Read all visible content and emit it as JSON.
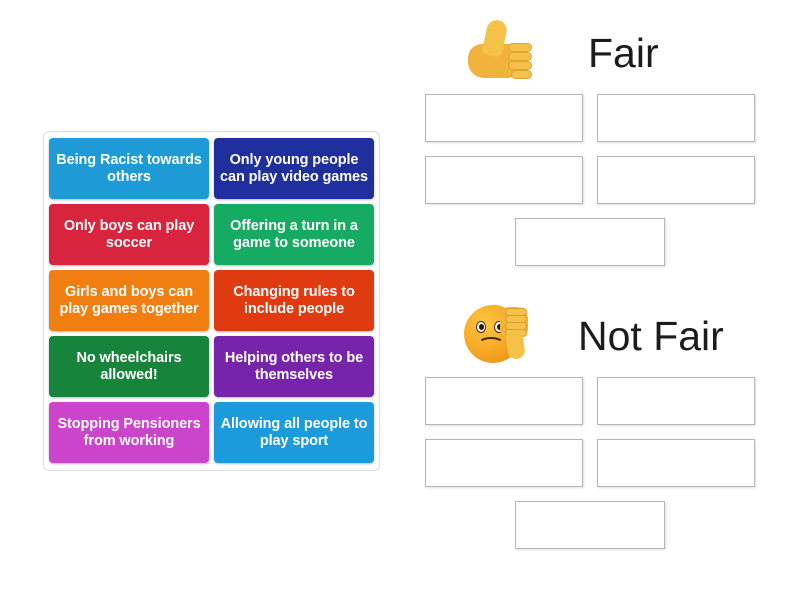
{
  "activity": {
    "type": "sort-into-groups",
    "tile_bank": {
      "tiles": [
        {
          "text": "Being Racist towards others",
          "color": "#1e9ad6"
        },
        {
          "text": "Only young people can play video games",
          "color": "#1f2f9e"
        },
        {
          "text": "Only boys can play soccer",
          "color": "#d8243c"
        },
        {
          "text": "Offering a turn in a game to someone",
          "color": "#16ab63"
        },
        {
          "text": "Girls and boys can play games together",
          "color": "#f07e11"
        },
        {
          "text": "Changing rules to include people",
          "color": "#e03a10"
        },
        {
          "text": "No wheelchairs allowed!",
          "color": "#16843a"
        },
        {
          "text": "Helping others to be themselves",
          "color": "#7724ad"
        },
        {
          "text": "Stopping Pensioners from working",
          "color": "#cc44cc"
        },
        {
          "text": "Allowing all people to play sport",
          "color": "#1b9bdb"
        }
      ]
    },
    "categories": [
      {
        "id": "fair",
        "title": "Fair",
        "icon": "thumbs-up-icon",
        "dropzones": [
          "",
          "",
          "",
          "",
          ""
        ]
      },
      {
        "id": "not-fair",
        "title": "Not Fair",
        "icon": "sad-face-thumbs-down-icon",
        "dropzones": [
          "",
          "",
          "",
          "",
          ""
        ]
      }
    ]
  }
}
